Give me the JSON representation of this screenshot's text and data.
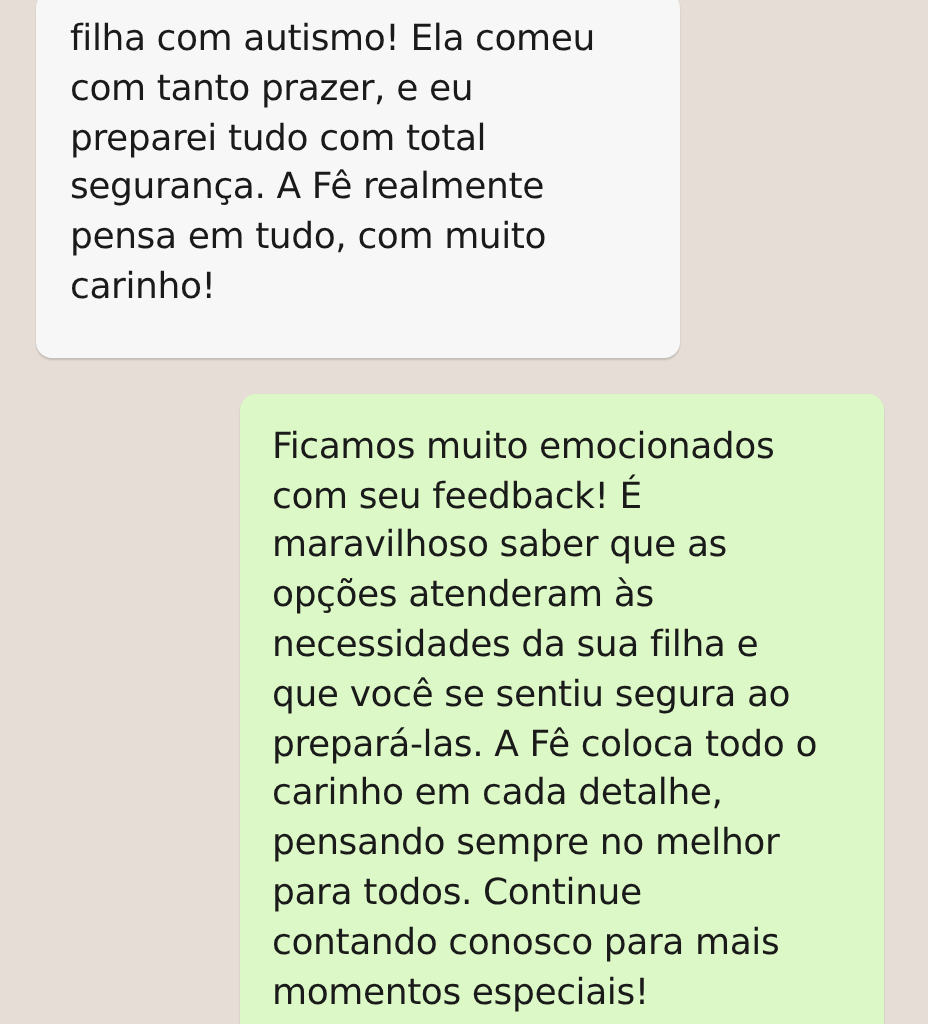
{
  "messages": [
    {
      "kind": "received",
      "lines": [
        "filha com autismo! Ela comeu",
        "com tanto prazer, e eu",
        "preparei tudo com total",
        "segurança. A Fê realmente",
        "pensa em tudo, com muito",
        "carinho!"
      ]
    },
    {
      "kind": "sent",
      "lines": [
        "Ficamos muito emocionados",
        "com seu feedback! É",
        "maravilhoso saber que as",
        "opções atenderam às",
        "necessidades da sua filha e",
        "que você se sentiu segura ao",
        "prepará-las. A Fê coloca todo o",
        "carinho em cada detalhe,",
        "pensando sempre no melhor",
        "para todos. Continue",
        "contando conosco para mais",
        "momentos especiais!"
      ]
    }
  ]
}
